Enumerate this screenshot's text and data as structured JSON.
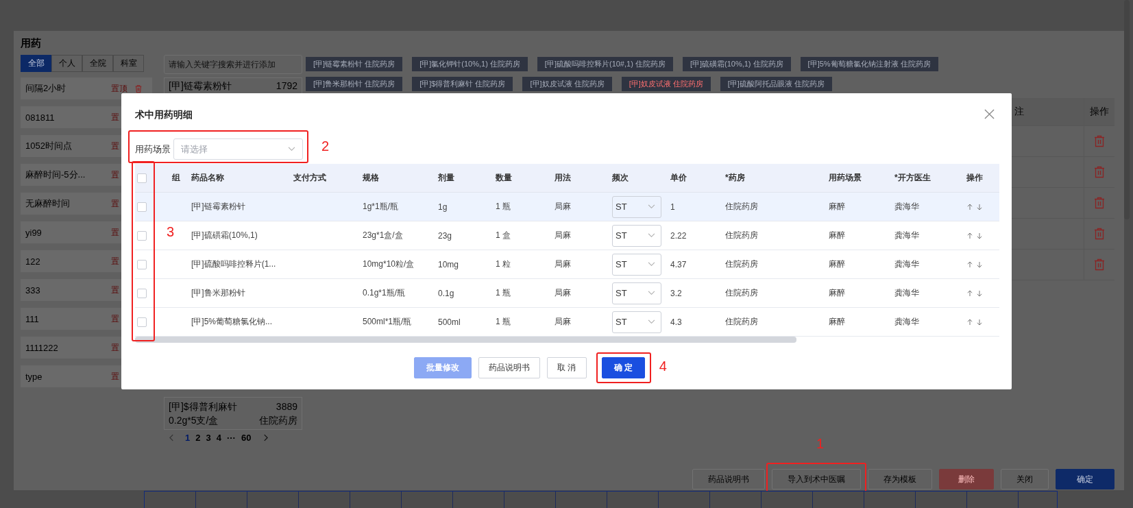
{
  "dialog": {
    "title": "用药",
    "scope_tabs": [
      {
        "label": "全部",
        "selected": true
      },
      {
        "label": "个人",
        "selected": false
      },
      {
        "label": "全院",
        "selected": false
      },
      {
        "label": "科室",
        "selected": false
      }
    ],
    "templates": [
      {
        "name": "间隔2小时",
        "action": "置顶",
        "deletable": true
      },
      {
        "name": "081811",
        "action": "置",
        "deletable": false
      },
      {
        "name": "1052时间点",
        "action": "置",
        "deletable": false
      },
      {
        "name": "麻醉时间-5分...",
        "action": "置",
        "deletable": false
      },
      {
        "name": "无麻醉时间",
        "action": "置",
        "deletable": false
      },
      {
        "name": "yi99",
        "action": "置",
        "deletable": false
      },
      {
        "name": "122",
        "action": "置",
        "deletable": false
      },
      {
        "name": "333",
        "action": "置",
        "deletable": false
      },
      {
        "name": "111",
        "action": "置",
        "deletable": false
      },
      {
        "name": "1111222",
        "action": "置",
        "deletable": false
      },
      {
        "name": "type",
        "action": "置",
        "deletable": false
      }
    ],
    "search": {
      "placeholder": "请输入关键字搜索并进行添加"
    },
    "top_result": {
      "name": "[甲]链霉素粉针",
      "count": "1792"
    },
    "bottom_result": {
      "name": "[甲]$得普利麻针",
      "count": "3889",
      "spec": "0.2g*5支/盒",
      "pharmacy": "住院药房"
    },
    "pagination": [
      {
        "label": "1",
        "selected": true
      },
      {
        "label": "2",
        "selected": false
      },
      {
        "label": "3",
        "selected": false
      },
      {
        "label": "4",
        "selected": false
      },
      {
        "label": "···",
        "selected": false
      },
      {
        "label": "60",
        "selected": false
      }
    ],
    "selected_tags": [
      {
        "label": "[甲]链霉素粉针 住院药房",
        "warning": false
      },
      {
        "label": "[甲]氯化钾针(10%,1) 住院药房",
        "warning": false
      },
      {
        "label": "[甲]硫酸吗啡控释片(10#,1) 住院药房",
        "warning": false
      },
      {
        "label": "[甲]硫磺霜(10%,1) 住院药房",
        "warning": false
      },
      {
        "label": "[甲]5%葡萄糖氯化钠注射液 住院药房",
        "warning": false
      },
      {
        "label": "[甲]鲁米那粉针 住院药房",
        "warning": false
      },
      {
        "label": "[甲]$得普利麻针 住院药房",
        "warning": false
      },
      {
        "label": "[甲]奴皮试液 住院药房",
        "warning": false
      },
      {
        "label": "[甲]奴皮试液 住院药房",
        "warning": true
      },
      {
        "label": "[甲]硫酸阿托品眼液 住院药房",
        "warning": false
      }
    ],
    "table": {
      "columns": [
        "注",
        "操作"
      ],
      "rows": [
        {
          "kind": "delete"
        },
        {
          "kind": "delete"
        },
        {
          "kind": "delete"
        },
        {
          "kind": "delete"
        },
        {
          "kind": "delete"
        }
      ]
    },
    "buttons": [
      {
        "label": "药品说明书",
        "kind": "default"
      },
      {
        "label": "导入到术中医嘱",
        "kind": "default",
        "annotation": "1"
      },
      {
        "label": "存为模板",
        "kind": "default"
      },
      {
        "label": "删除",
        "kind": "danger"
      },
      {
        "label": "关闭",
        "kind": "default"
      },
      {
        "label": "确定",
        "kind": "primary"
      }
    ]
  },
  "modal": {
    "title": "术中用药明细",
    "scene_field": {
      "label": "用药场景",
      "placeholder": "请选择",
      "annotation": "2"
    },
    "table": {
      "select_all_checked": false,
      "checkbox_annotation": "3",
      "columns": [
        "组",
        "药品名称",
        "支付方式",
        "规格",
        "剂量",
        "数量",
        "用法",
        "频次",
        "单价",
        "*药房",
        "用药场景",
        "*开方医生",
        "操作"
      ],
      "rows": [
        {
          "selected": true,
          "checked": false,
          "name": "[甲]链霉素粉针",
          "spec": "1g*1瓶/瓶",
          "dose": "1g",
          "quantity": "1 瓶",
          "usage": "局麻",
          "frequency": "ST",
          "price": "1",
          "pharmacy": "住院药房",
          "scene": "麻醉",
          "doctor": "龚海华"
        },
        {
          "selected": false,
          "checked": false,
          "name": "[甲]硫磺霜(10%,1)",
          "spec": "23g*1盒/盒",
          "dose": "23g",
          "quantity": "1 盒",
          "usage": "局麻",
          "frequency": "ST",
          "price": "2.22",
          "pharmacy": "住院药房",
          "scene": "麻醉",
          "doctor": "龚海华"
        },
        {
          "selected": false,
          "checked": false,
          "name": "[甲]硫酸吗啡控释片(1...",
          "spec": "10mg*10粒/盒",
          "dose": "10mg",
          "quantity": "1 粒",
          "usage": "局麻",
          "frequency": "ST",
          "price": "4.37",
          "pharmacy": "住院药房",
          "scene": "麻醉",
          "doctor": "龚海华"
        },
        {
          "selected": false,
          "checked": false,
          "name": "[甲]鲁米那粉针",
          "spec": "0.1g*1瓶/瓶",
          "dose": "0.1g",
          "quantity": "1 瓶",
          "usage": "局麻",
          "frequency": "ST",
          "price": "3.2",
          "pharmacy": "住院药房",
          "scene": "麻醉",
          "doctor": "龚海华"
        },
        {
          "selected": false,
          "checked": false,
          "name": "[甲]5%葡萄糖氯化钠...",
          "spec": "500ml*1瓶/瓶",
          "dose": "500ml",
          "quantity": "1 瓶",
          "usage": "局麻",
          "frequency": "ST",
          "price": "4.3",
          "pharmacy": "住院药房",
          "scene": "麻醉",
          "doctor": "龚海华"
        }
      ]
    },
    "buttons": [
      {
        "label": "批量修改",
        "kind": "primary",
        "disabled": true
      },
      {
        "label": "药品说明书",
        "kind": "default",
        "disabled": false
      },
      {
        "label": "取 消",
        "kind": "default",
        "disabled": false
      },
      {
        "label": "确 定",
        "kind": "primary",
        "disabled": false,
        "annotation": "4"
      }
    ]
  }
}
